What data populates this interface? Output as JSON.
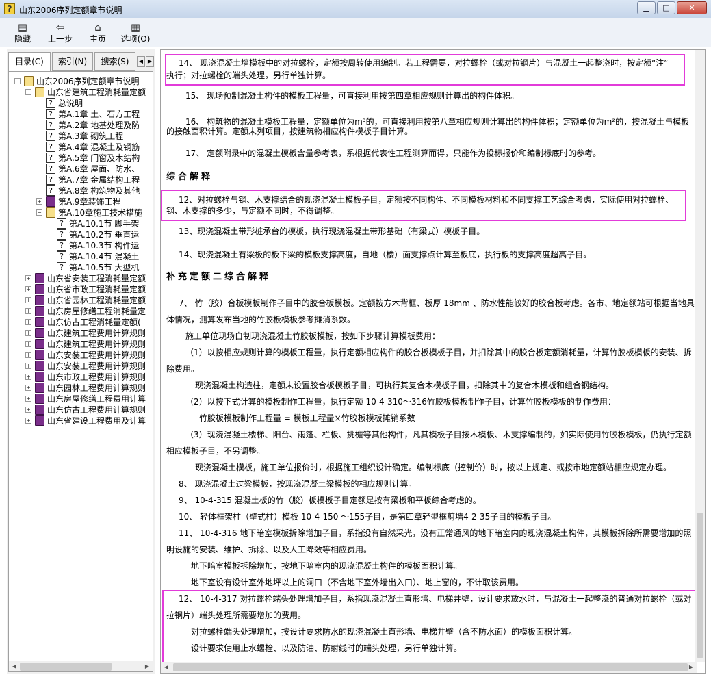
{
  "window": {
    "title": "山东2006序列定额章节说明",
    "controls": {
      "minimize": "▁",
      "restore": "□",
      "close": "✕"
    }
  },
  "toolbar": {
    "hide": "隐藏",
    "back": "上一步",
    "home": "主页",
    "options": "选项(O)"
  },
  "tabs": [
    "目录(C)",
    "索引(N)",
    "搜索(S)"
  ],
  "tree": [
    {
      "label": "山东2006序列定额章节说明",
      "icon": "book-open",
      "level": 0,
      "expander": "−"
    },
    {
      "label": "山东省建筑工程消耗量定额",
      "icon": "book-open",
      "level": 1,
      "expander": "−"
    },
    {
      "label": "总说明",
      "icon": "page",
      "level": 2
    },
    {
      "label": "第A.1章 土、石方工程",
      "icon": "page",
      "level": 2
    },
    {
      "label": "第A.2章 地基处理及防",
      "icon": "page",
      "level": 2
    },
    {
      "label": "第A.3章 砌筑工程",
      "icon": "page",
      "level": 2
    },
    {
      "label": "第A.4章 混凝土及钢筋",
      "icon": "page",
      "level": 2
    },
    {
      "label": "第A.5章 门窗及木结构",
      "icon": "page",
      "level": 2
    },
    {
      "label": "第A.6章 屋面、防水、",
      "icon": "page",
      "level": 2
    },
    {
      "label": "第A.7章 金属结构工程",
      "icon": "page",
      "level": 2
    },
    {
      "label": "第A.8章 构筑物及其他",
      "icon": "page",
      "level": 2
    },
    {
      "label": "第A.9章装饰工程",
      "icon": "book",
      "level": 2,
      "expander": "+"
    },
    {
      "label": "第A.10章施工技术措施",
      "icon": "book-open",
      "level": 2,
      "expander": "−"
    },
    {
      "label": "第A.10.1节 脚手架",
      "icon": "page",
      "level": 3
    },
    {
      "label": "第A.10.2节 垂直运",
      "icon": "page",
      "level": 3
    },
    {
      "label": "第A.10.3节 构件运",
      "icon": "page",
      "level": 3
    },
    {
      "label": "第A.10.4节 混凝土",
      "icon": "page",
      "level": 3
    },
    {
      "label": "第A.10.5节 大型机",
      "icon": "page",
      "level": 3
    },
    {
      "label": "山东省安装工程消耗量定额",
      "icon": "book",
      "level": 1,
      "expander": "+"
    },
    {
      "label": "山东省市政工程消耗量定额",
      "icon": "book",
      "level": 1,
      "expander": "+"
    },
    {
      "label": "山东省园林工程消耗量定额",
      "icon": "book",
      "level": 1,
      "expander": "+"
    },
    {
      "label": "山东房屋修缮工程消耗量定",
      "icon": "book",
      "level": 1,
      "expander": "+"
    },
    {
      "label": "山东仿古工程消耗量定额(",
      "icon": "book",
      "level": 1,
      "expander": "+"
    },
    {
      "label": "山东建筑工程费用计算规则",
      "icon": "book",
      "level": 1,
      "expander": "+"
    },
    {
      "label": "山东建筑工程费用计算规则",
      "icon": "book",
      "level": 1,
      "expander": "+"
    },
    {
      "label": "山东安装工程费用计算规则",
      "icon": "book",
      "level": 1,
      "expander": "+"
    },
    {
      "label": "山东安装工程费用计算规则",
      "icon": "book",
      "level": 1,
      "expander": "+"
    },
    {
      "label": "山东市政工程费用计算规则",
      "icon": "book",
      "level": 1,
      "expander": "+"
    },
    {
      "label": "山东园林工程费用计算规则",
      "icon": "book",
      "level": 1,
      "expander": "+"
    },
    {
      "label": "山东房屋修缮工程费用计算",
      "icon": "book",
      "level": 1,
      "expander": "+"
    },
    {
      "label": "山东仿古工程费用计算规则",
      "icon": "book",
      "level": 1,
      "expander": "+"
    },
    {
      "label": "山东省建设工程费用及计算",
      "icon": "book",
      "level": 1,
      "expander": "+"
    }
  ],
  "content": {
    "p1a": "14、 现浇混凝土墙模板中的对拉螺栓，定额按周转使用编制。若工程需要，对拉螺栓（或对拉钢片）与混凝土一起整浇时，按定额“注”",
    "p1b": "执行；对拉螺栓的端头处理，另行单独计算。",
    "p2": "15、 现场预制混凝土构件的模板工程量，可直接利用按第四章相应规则计算出的构件体积。",
    "p3a": "16、 构筑物的混凝土模板工程量，定额单位为m³的，可直接利用按第八章相应规则计算出的构件体积；定额单位为m²的，按混凝土与模板",
    "p3b": "的接触面积计算。定额未列项目，按建筑物相应构件模板子目计算。",
    "p4": "17、 定额附录中的混凝土模板含量参考表，系根据代表性工程测算而得，只能作为投标报价和编制标底时的参考。",
    "h1": "综合解释",
    "p5a": "12、对拉螺栓与钢、木支撑结合的现浇混凝土模板子目，定额按不同构件、不同模板材料和不同支撑工艺综合考虑，实际使用对拉螺栓、",
    "p5b": "钢、木支撑的多少，与定额不同时，不得调整。",
    "p6": "13、现浇混凝土带形桩承台的模板，执行现浇混凝土带形基础（有梁式）模板子目。",
    "p7": "14、现浇混凝土有梁板的板下梁的模板支撑高度，自地（楼）面支撑点计算至板底，执行板的支撑高度超高子目。",
    "h2": "补充定额二综合解释",
    "p8a": "7、 竹（胶）合板模板制作子目中的胶合板模板。定额按方木背框、板厚 18mm 、防水性能较好的胶合板考虑。各市、地定额站可根据当地具",
    "p8b": "体情况，测算发布当地的竹胶板模板参考摊消系数。",
    "p9": "施工单位现场自制现浇混凝土竹胶板模板，按如下步骤计算模板费用：",
    "p10a": "（1）以按相应规则计算的模板工程量，执行定额相应构件的胶合板模板子目，并扣除其中的胶合板定额消耗量，计算竹胶板模板的安装、拆",
    "p10b": "除费用。",
    "p11": "现浇混凝土构造柱，定额未设置胶合板模板子目，可执行其复合木模板子目，扣除其中的复合木模板和组合钢结构。",
    "p12": "（2）以按下式计算的模板制作工程量，执行定额 10-4-310～316竹胶板模板制作子目，计算竹胶板模板的制作费用：",
    "p13": "竹胶板模板制作工程量 = 模板工程量×竹胶板模板摊销系数",
    "p14a": "（3）现浇混凝土楼梯、阳台、雨篷、栏板、挑檐等其他构件，凡其模板子目按木模板、木支撑编制的，如实际使用竹胶板模板，仍执行定额",
    "p14b": "相应模板子目，不另调整。",
    "p15": "现浇混凝土模板，施工单位报价时，根据施工组织设计确定。编制标底（控制价）时，按以上规定、或按市地定额站相应规定办理。",
    "p16": "8、 现浇混凝土过梁模板，按现浇混凝土梁模板的相应规则计算。",
    "p17": "9、 10-4-315 混凝土板的竹（胶）板模板子目定额是按有梁板和平板综合考虑的。",
    "p18": "10、 轻体框架柱（壁式柱）模板 10-4-150 ～155子目，是第四章轻型框剪墙4-2-35子目的模板子目。",
    "p19a": "11、 10-4-316 地下暗室模板拆除增加子目，系指没有自然采光，没有正常通风的地下暗室内的现浇混凝土构件，其模板拆除所需要增加的照",
    "p19b": "明设施的安装、维护、拆除、以及人工降效等相应费用。",
    "p20": "地下暗室模板拆除增加，按地下暗室内的现浇混凝土构件的模板面积计算。",
    "p21": "地下室设有设计室外地坪以上的洞口（不含地下室外墙出入口）、地上窗的，不计取该费用。",
    "p22a": "12、 10-4-317 对拉螺栓端头处理增加子目，系指现浇混凝土直形墙、电梯井壁，设计要求放水时，与混凝土一起整浇的普通对拉螺栓（或对",
    "p22b": "拉钢片）端头处理所需要增加的费用。",
    "p23": "对拉螺栓端头处理增加，按设计要求防水的现浇混凝土直形墙、电梯井壁（含不防水面）的模板面积计算。",
    "p24": "设计要求使用止水螺栓、以及防油、防射线时的端头处理，另行单独计算。"
  }
}
